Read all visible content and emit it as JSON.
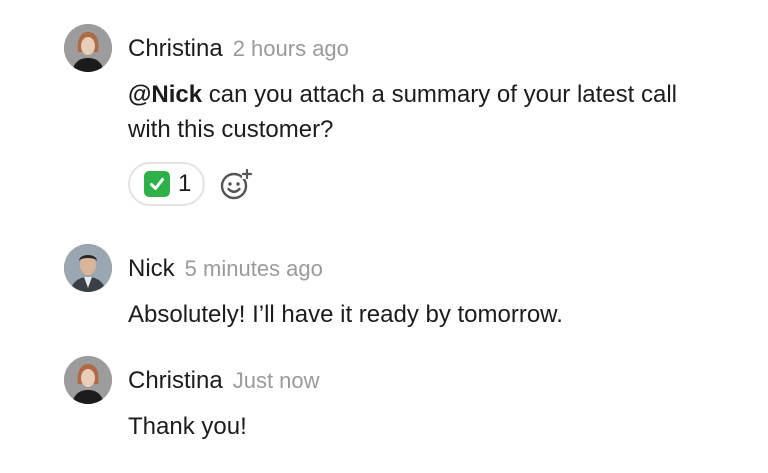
{
  "messages": [
    {
      "author": "Christina",
      "timestamp": "2 hours ago",
      "mention": "@Nick",
      "text": " can you attach a summary of your latest call with this customer?",
      "reactions": [
        {
          "emoji": "check-mark-button-icon",
          "count": "1"
        }
      ]
    },
    {
      "author": "Nick",
      "timestamp": "5 minutes ago",
      "text": "Absolutely! I’ll have it ready by tomorrow."
    },
    {
      "author": "Christina",
      "timestamp": "Just now",
      "text": "Thank you!"
    }
  ],
  "colors": {
    "author": "#1c1c1e",
    "timestamp": "#9a9a9e",
    "reaction_border": "#e3e3e6",
    "check_green": "#2fb14a"
  }
}
